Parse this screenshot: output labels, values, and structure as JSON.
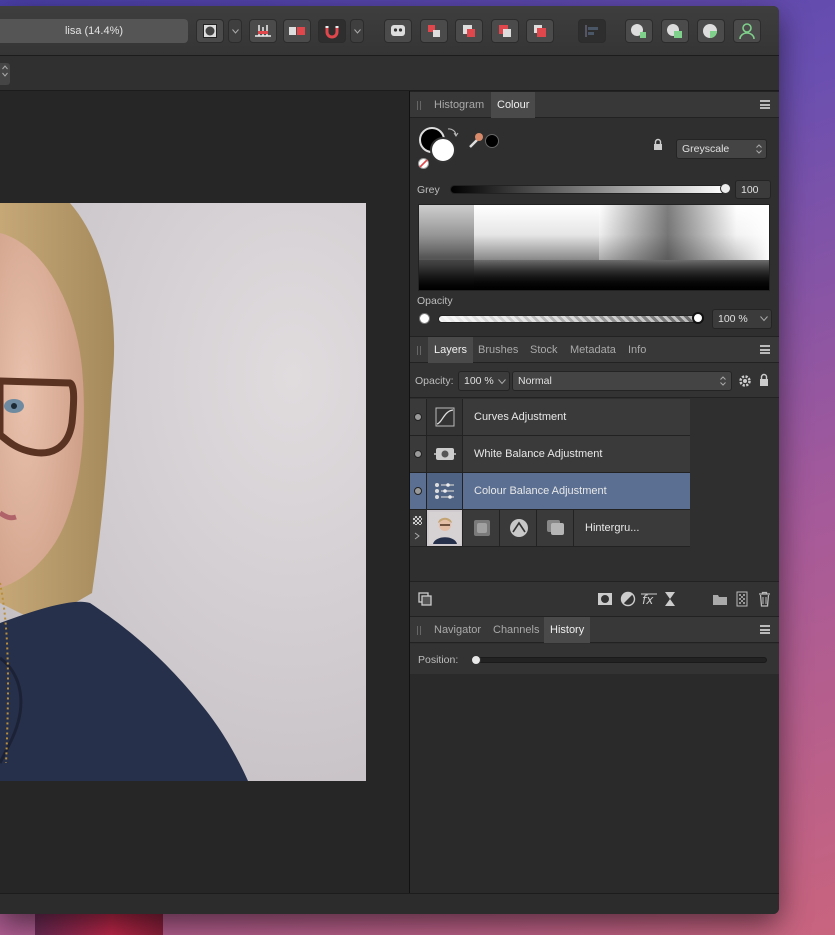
{
  "window": {
    "title": "lisa (14.4%)"
  },
  "colour_panel": {
    "tabs": [
      {
        "label": "Histogram",
        "active": false
      },
      {
        "label": "Colour",
        "active": true
      }
    ],
    "model": "Greyscale",
    "grey_label": "Grey",
    "grey_value": "100",
    "opacity_label": "Opacity",
    "opacity_value": "100 %"
  },
  "layers_panel": {
    "tabs": [
      {
        "label": "Layers",
        "active": true
      },
      {
        "label": "Brushes",
        "active": false
      },
      {
        "label": "Stock",
        "active": false
      },
      {
        "label": "Metadata",
        "active": false
      },
      {
        "label": "Info",
        "active": false
      }
    ],
    "opacity_label": "Opacity:",
    "opacity_value": "100 %",
    "blend_mode": "Normal",
    "layers": [
      {
        "name": "Curves Adjustment",
        "icon": "curves-icon",
        "selected": false
      },
      {
        "name": "White Balance Adjustment",
        "icon": "white-balance-icon",
        "selected": false
      },
      {
        "name": "Colour Balance Adjustment",
        "icon": "colour-balance-icon",
        "selected": true
      },
      {
        "name": "Hintergru...",
        "icon": "photo-thumbnail",
        "selected": false
      }
    ]
  },
  "history_panel": {
    "tabs": [
      {
        "label": "Navigator",
        "active": false
      },
      {
        "label": "Channels",
        "active": false
      },
      {
        "label": "History",
        "active": true
      }
    ],
    "position_label": "Position:"
  },
  "colors": {
    "selected_layer": "#5a6f92",
    "panel_bg": "#2f2f2f",
    "accent_red": "#e0474c",
    "accent_green": "#7fd08a"
  }
}
